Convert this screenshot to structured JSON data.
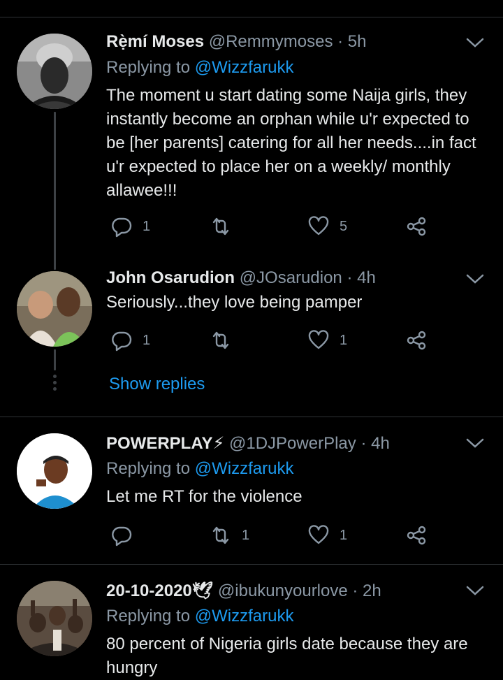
{
  "tweets": [
    {
      "name": "Rẹ̀mí Moses",
      "handle": "@Remmymoses",
      "time": "· 5h",
      "replying_prefix": "Replying to ",
      "replying_to": "@Wizzfarukk",
      "text": "The moment u start dating some Naija girls, they instantly become an orphan while u'r expected to be [her parents] catering for all her needs....in fact u'r expected to place her on a weekly/ monthly allawee!!!",
      "replies": "1",
      "retweets": "",
      "likes": "5"
    },
    {
      "name": "John Osarudion",
      "handle": "@JOsarudion",
      "time": "· 4h",
      "text": "Seriously...they love being pamper",
      "replies": "1",
      "retweets": "",
      "likes": "1"
    },
    {
      "name": "POWERPLAY⚡",
      "handle": "@1DJPowerPlay",
      "time": "· 4h",
      "replying_prefix": "Replying to ",
      "replying_to": "@Wizzfarukk",
      "text": "Let me RT for the violence",
      "replies": "",
      "retweets": "1",
      "likes": "1"
    },
    {
      "name": "20-10-2020🕊",
      "handle": "@ibukunyourlove",
      "time": "· 2h",
      "replying_prefix": "Replying to ",
      "replying_to": "@Wizzfarukk",
      "text": "80 percent of Nigeria girls date because they are hungry"
    }
  ],
  "show_replies": "Show replies",
  "colors": {
    "accent": "#1d9bf0",
    "muted": "#8b98a5",
    "text": "#e7e9ea",
    "background": "#000000"
  }
}
